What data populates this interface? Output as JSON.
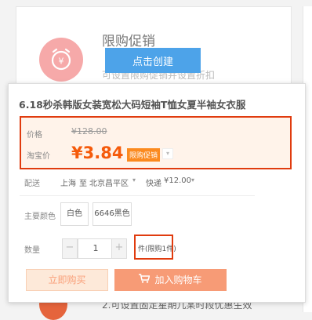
{
  "background": {
    "card_title": "限购促销",
    "create_button": "点击创建",
    "card_subtitle": "可设置限购促销并设置折扣",
    "footer_text": "2.可设置固定星期几某时段优惠生效"
  },
  "product": {
    "title": "6.18秒杀韩版女装宽松大码短袖T恤女夏半袖女衣服",
    "price_label": "价格",
    "original_price": "¥128.00",
    "taobao_price_label": "淘宝价",
    "current_price": "¥3.84",
    "promo_badge": "限购促销",
    "shipping_label": "配送",
    "ship_from": "上海",
    "ship_to_word": "至",
    "ship_to": "北京昌平区",
    "ship_method": "快递",
    "ship_fee": "¥12.00",
    "color_label": "主要颜色",
    "colors": [
      "白色",
      "6646黑色"
    ],
    "quantity_label": "数量",
    "quantity": "1",
    "limit_text": "件(限购1件)",
    "buy_now": "立即购买",
    "add_to_cart": "加入购物车"
  },
  "colors": {
    "accent": "#f55a0a",
    "highlight_border": "#e03b0e",
    "button_blue": "#4da3e9"
  }
}
